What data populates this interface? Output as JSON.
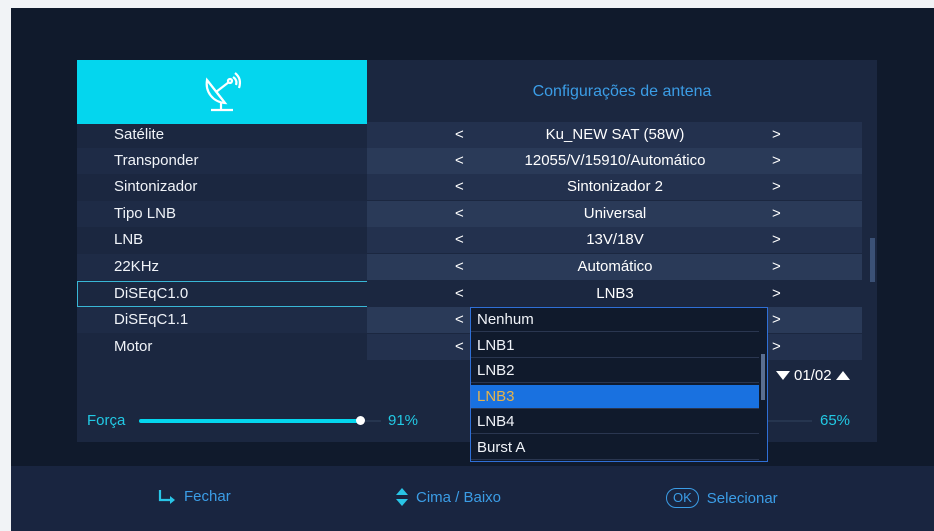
{
  "header": {
    "title": "Configurações de antena",
    "icon": "satellite-dish-icon"
  },
  "rows": [
    {
      "label": "Satélite",
      "value": "Ku_NEW SAT (58W)"
    },
    {
      "label": "Transponder",
      "value": "12055/V/15910/Automático"
    },
    {
      "label": "Sintonizador",
      "value": "Sintonizador 2"
    },
    {
      "label": "Tipo LNB",
      "value": "Universal"
    },
    {
      "label": "LNB",
      "value": "13V/18V"
    },
    {
      "label": "22KHz",
      "value": "Automático"
    },
    {
      "label": "DiSEqC1.0",
      "value": "LNB3"
    },
    {
      "label": "DiSEqC1.1",
      "value": ""
    },
    {
      "label": "Motor",
      "value": ""
    }
  ],
  "arrows": {
    "left": "<",
    "right": ">"
  },
  "dropdown": {
    "options": [
      "Nenhum",
      "LNB1",
      "LNB2",
      "LNB3",
      "LNB4",
      "Burst A"
    ],
    "selected_index": 3
  },
  "pager": {
    "text": "01/02"
  },
  "signal": {
    "strength_label": "Força",
    "strength_value": "91%",
    "quality_value": "65%",
    "strength_level": 0.91
  },
  "footer": {
    "close": "Fechar",
    "updown": "Cima / Baixo",
    "ok_key": "OK",
    "select": "Selecionar"
  },
  "colors": {
    "accent": "#04d6ee",
    "highlight": "#1971e0",
    "text_blue": "#3b9de6",
    "selected_text": "#e6b34b"
  }
}
